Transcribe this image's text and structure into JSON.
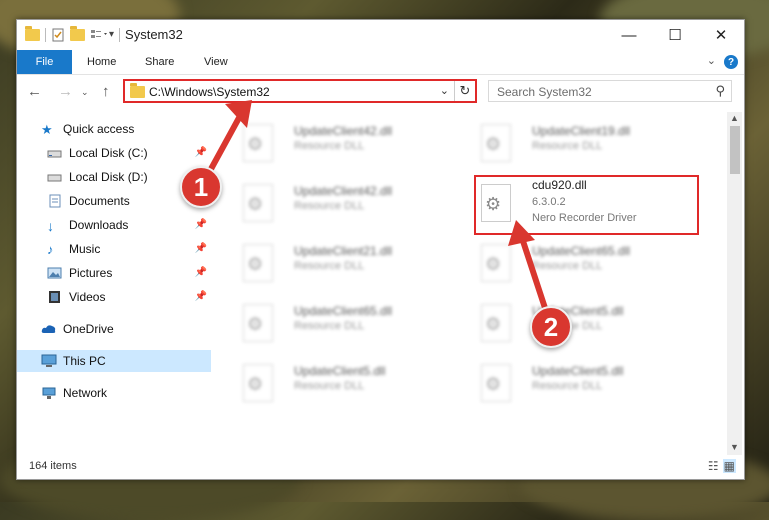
{
  "window": {
    "title": "System32",
    "minimize_glyph": "—",
    "maximize_glyph": "☐",
    "close_glyph": "✕"
  },
  "ribbon": {
    "file": "File",
    "home": "Home",
    "share": "Share",
    "view": "View",
    "help": "?"
  },
  "address": {
    "path": "C:\\Windows\\System32",
    "search_placeholder": "Search System32"
  },
  "sidebar": {
    "items": [
      {
        "label": "Quick access",
        "icon": "star-icon"
      },
      {
        "label": "Local Disk (C:)",
        "icon": "drive-icon",
        "pinned": true
      },
      {
        "label": "Local Disk (D:)",
        "icon": "drive-icon",
        "pinned": false
      },
      {
        "label": "Documents",
        "icon": "documents-icon",
        "pinned": true
      },
      {
        "label": "Downloads",
        "icon": "downloads-icon",
        "pinned": true
      },
      {
        "label": "Music",
        "icon": "music-icon",
        "pinned": true
      },
      {
        "label": "Pictures",
        "icon": "pictures-icon",
        "pinned": true
      },
      {
        "label": "Videos",
        "icon": "videos-icon",
        "pinned": true
      },
      {
        "label": "OneDrive",
        "icon": "cloud-icon"
      },
      {
        "label": "This PC",
        "icon": "computer-icon",
        "selected": true
      },
      {
        "label": "Network",
        "icon": "network-icon"
      }
    ]
  },
  "files": {
    "left": [
      {
        "name": "UpdateClient42.dll",
        "type": "Resource DLL"
      },
      {
        "name": "UpdateClient42.dll",
        "type": "Resource DLL"
      },
      {
        "name": "UpdateClient21.dll",
        "type": "Resource DLL"
      },
      {
        "name": "UpdateClient65.dll",
        "type": "Resource DLL"
      },
      {
        "name": "UpdateClient5.dll",
        "type": "Resource DLL"
      }
    ],
    "right": [
      {
        "name": "UpdateClient19.dll",
        "type": "Resource DLL"
      },
      {
        "name": "cdu920.dll",
        "version": "6.3.0.2",
        "type": "Nero Recorder Driver",
        "highlighted": true
      },
      {
        "name": "UpdateClient65.dll",
        "type": "Resource DLL"
      },
      {
        "name": "UpdateClient5.dll",
        "type": "Resource DLL"
      },
      {
        "name": "UpdateClient5.dll",
        "type": "Resource DLL"
      }
    ]
  },
  "status": {
    "count": "164 items"
  },
  "annotations": {
    "badge1": "1",
    "badge2": "2"
  },
  "colors": {
    "accent": "#1979ca",
    "highlight": "#e02929",
    "selected_bg": "#cce8ff"
  }
}
